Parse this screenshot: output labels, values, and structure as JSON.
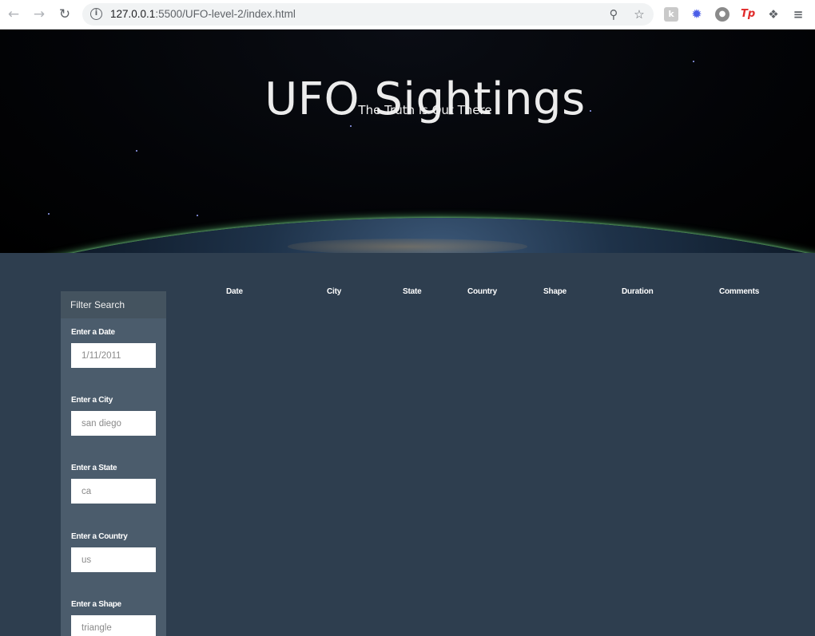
{
  "browser": {
    "url_host": "127.0.0.1",
    "url_rest": ":5500/UFO-level-2/index.html"
  },
  "hero": {
    "title": "UFO Sightings",
    "subtitle": "The Truth is Out There"
  },
  "filter": {
    "heading": "Filter Search",
    "fields": [
      {
        "label": "Enter a Date",
        "placeholder": "1/11/2011"
      },
      {
        "label": "Enter a City",
        "placeholder": "san diego"
      },
      {
        "label": "Enter a State",
        "placeholder": "ca"
      },
      {
        "label": "Enter a Country",
        "placeholder": "us"
      },
      {
        "label": "Enter a Shape",
        "placeholder": "triangle"
      }
    ]
  },
  "table": {
    "columns": [
      "Date",
      "City",
      "State",
      "Country",
      "Shape",
      "Duration",
      "Comments"
    ],
    "rows": []
  },
  "colors": {
    "page_bg": "#2e3e4f",
    "sidebar_bg": "#4b5c6c",
    "sidebar_head_bg": "#44535f"
  }
}
